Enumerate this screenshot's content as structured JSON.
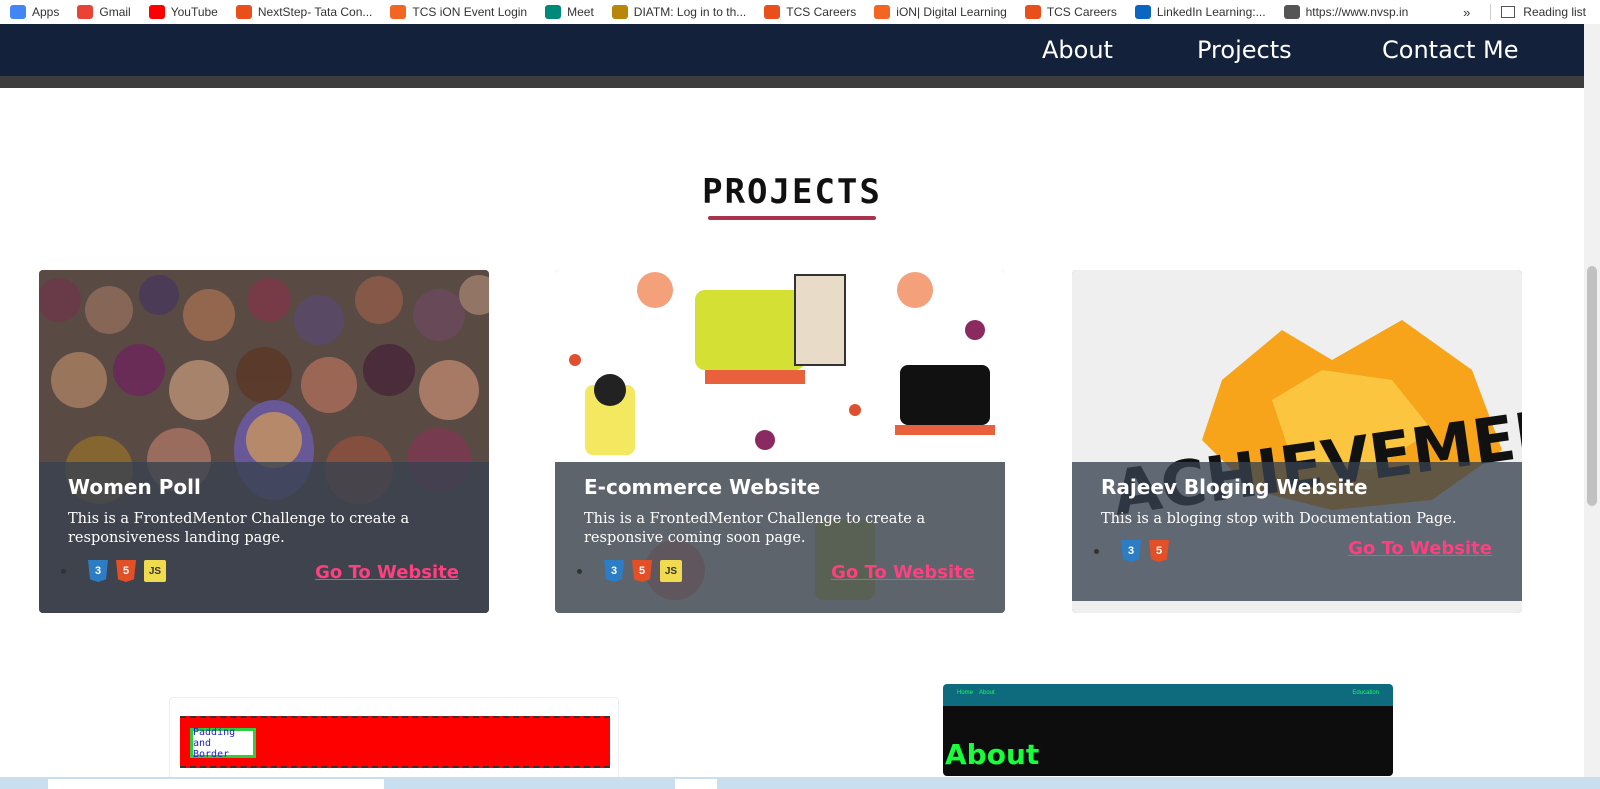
{
  "bookmarks": [
    {
      "label": "Apps",
      "icon": "apps-grid-icon",
      "color": "#4285f4"
    },
    {
      "label": "Gmail",
      "icon": "gmail-icon",
      "color": "#ea4335"
    },
    {
      "label": "YouTube",
      "icon": "youtube-icon",
      "color": "#ff0000"
    },
    {
      "label": "NextStep- Tata Con...",
      "icon": "tcs-icon",
      "color": "#e94e1b"
    },
    {
      "label": "TCS iON Event Login",
      "icon": "tcs-ion-icon",
      "color": "#f26522"
    },
    {
      "label": "Meet",
      "icon": "meet-icon",
      "color": "#00897b"
    },
    {
      "label": "DIATM: Log in to th...",
      "icon": "diatm-icon",
      "color": "#b8860b"
    },
    {
      "label": "TCS Careers",
      "icon": "tcs-icon",
      "color": "#e94e1b"
    },
    {
      "label": "iON| Digital Learning",
      "icon": "tcs-ion-icon",
      "color": "#f26522"
    },
    {
      "label": "TCS Careers",
      "icon": "tcs-icon",
      "color": "#e94e1b"
    },
    {
      "label": "LinkedIn Learning:...",
      "icon": "linkedin-learning-icon",
      "color": "#0a66c2"
    },
    {
      "label": "https://www.nvsp.in",
      "icon": "nvsp-icon",
      "color": "#555555"
    }
  ],
  "bookmarks_overflow": "»",
  "reading_list": "Reading list",
  "nav": {
    "about": "About",
    "projects": "Projects",
    "contact": "Contact Me"
  },
  "section": {
    "title": "PROJECTS"
  },
  "projects": [
    {
      "title": "Women Poll",
      "description": "This is a FrontedMentor Challenge to create a responsiveness landing page.",
      "tech": [
        "CSS3",
        "HTML5",
        "JS"
      ],
      "link": "Go To Website"
    },
    {
      "title": "E-commerce Website",
      "description": "This is a FrontedMentor Challenge to create a responsive coming soon page.",
      "tech": [
        "CSS3",
        "HTML5",
        "JS"
      ],
      "link": "Go To Website"
    },
    {
      "title": "Rajeev Bloging Website",
      "description": "This is a bloging stop with Documentation Page.",
      "tech": [
        "CSS3",
        "HTML5"
      ],
      "link": "Go To Website"
    }
  ],
  "lower_cards": {
    "padding_button": "Padding and Border",
    "about_nav": [
      "Home",
      "About"
    ],
    "about_nav_right": "Education",
    "about_heading": "About"
  },
  "colors": {
    "nav_bg": "#13223a",
    "accent_underline": "#a8334e",
    "link_pink": "#ff3f7f"
  }
}
